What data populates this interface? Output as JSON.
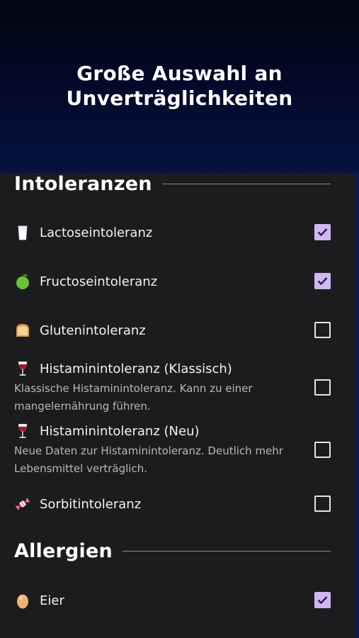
{
  "header": {
    "title_line1": "Große Auswahl an",
    "title_line2": "Unverträglichkeiten"
  },
  "sections": [
    {
      "title": "Intoleranzen",
      "items": [
        {
          "icon": "milk-glass-icon",
          "label": "Lactoseintoleranz",
          "description": "",
          "checked": true
        },
        {
          "icon": "green-apple-icon",
          "label": "Fructoseintoleranz",
          "description": "",
          "checked": true
        },
        {
          "icon": "bread-icon",
          "label": "Glutenintoleranz",
          "description": "",
          "checked": false
        },
        {
          "icon": "wine-glass-icon",
          "label": "Histaminintoleranz (Klassisch)",
          "description": "Klassische Histaminintoleranz. Kann zu einer mangelernährung führen.",
          "checked": false
        },
        {
          "icon": "wine-glass-icon",
          "label": "Histaminintoleranz (Neu)",
          "description": "Neue Daten zur Histaminintoleranz. Deutlich mehr Lebensmittel verträglich.",
          "checked": false
        },
        {
          "icon": "candy-icon",
          "label": "Sorbitintoleranz",
          "description": "",
          "checked": false
        }
      ]
    },
    {
      "title": "Allergien",
      "items": [
        {
          "icon": "egg-icon",
          "label": "Eier",
          "description": "",
          "checked": true
        }
      ]
    }
  ],
  "colors": {
    "checkbox_checked": "#cdb8f2",
    "panel_bg": "#1c1c1e",
    "header_bg": "#03092a"
  }
}
